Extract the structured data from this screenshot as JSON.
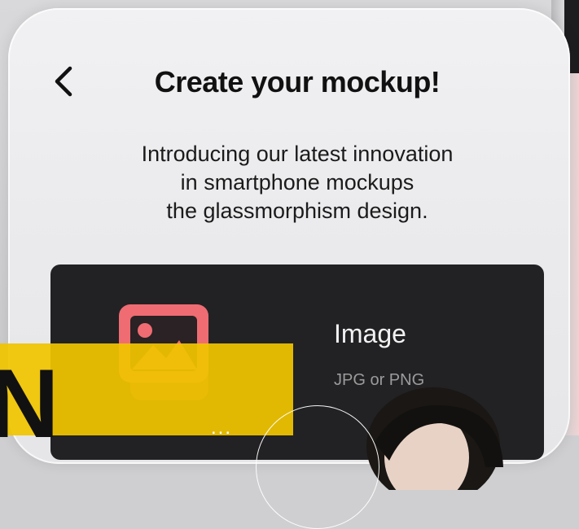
{
  "header": {
    "back_icon": "chevron-left-icon",
    "title": "Create your mockup!"
  },
  "intro": {
    "lines": [
      "Introducing our latest innovation",
      "in smartphone mockups",
      "the glassmorphism design."
    ]
  },
  "upload_card": {
    "icon": "image-icon",
    "title": "Image",
    "subtitle": "JPG or PNG"
  },
  "overlay": {
    "large_letter": "N",
    "dots": "..."
  },
  "colors": {
    "card_dark": "#222224",
    "icon_pink": "#ef6c73",
    "overlay_yellow": "#f0c400"
  }
}
